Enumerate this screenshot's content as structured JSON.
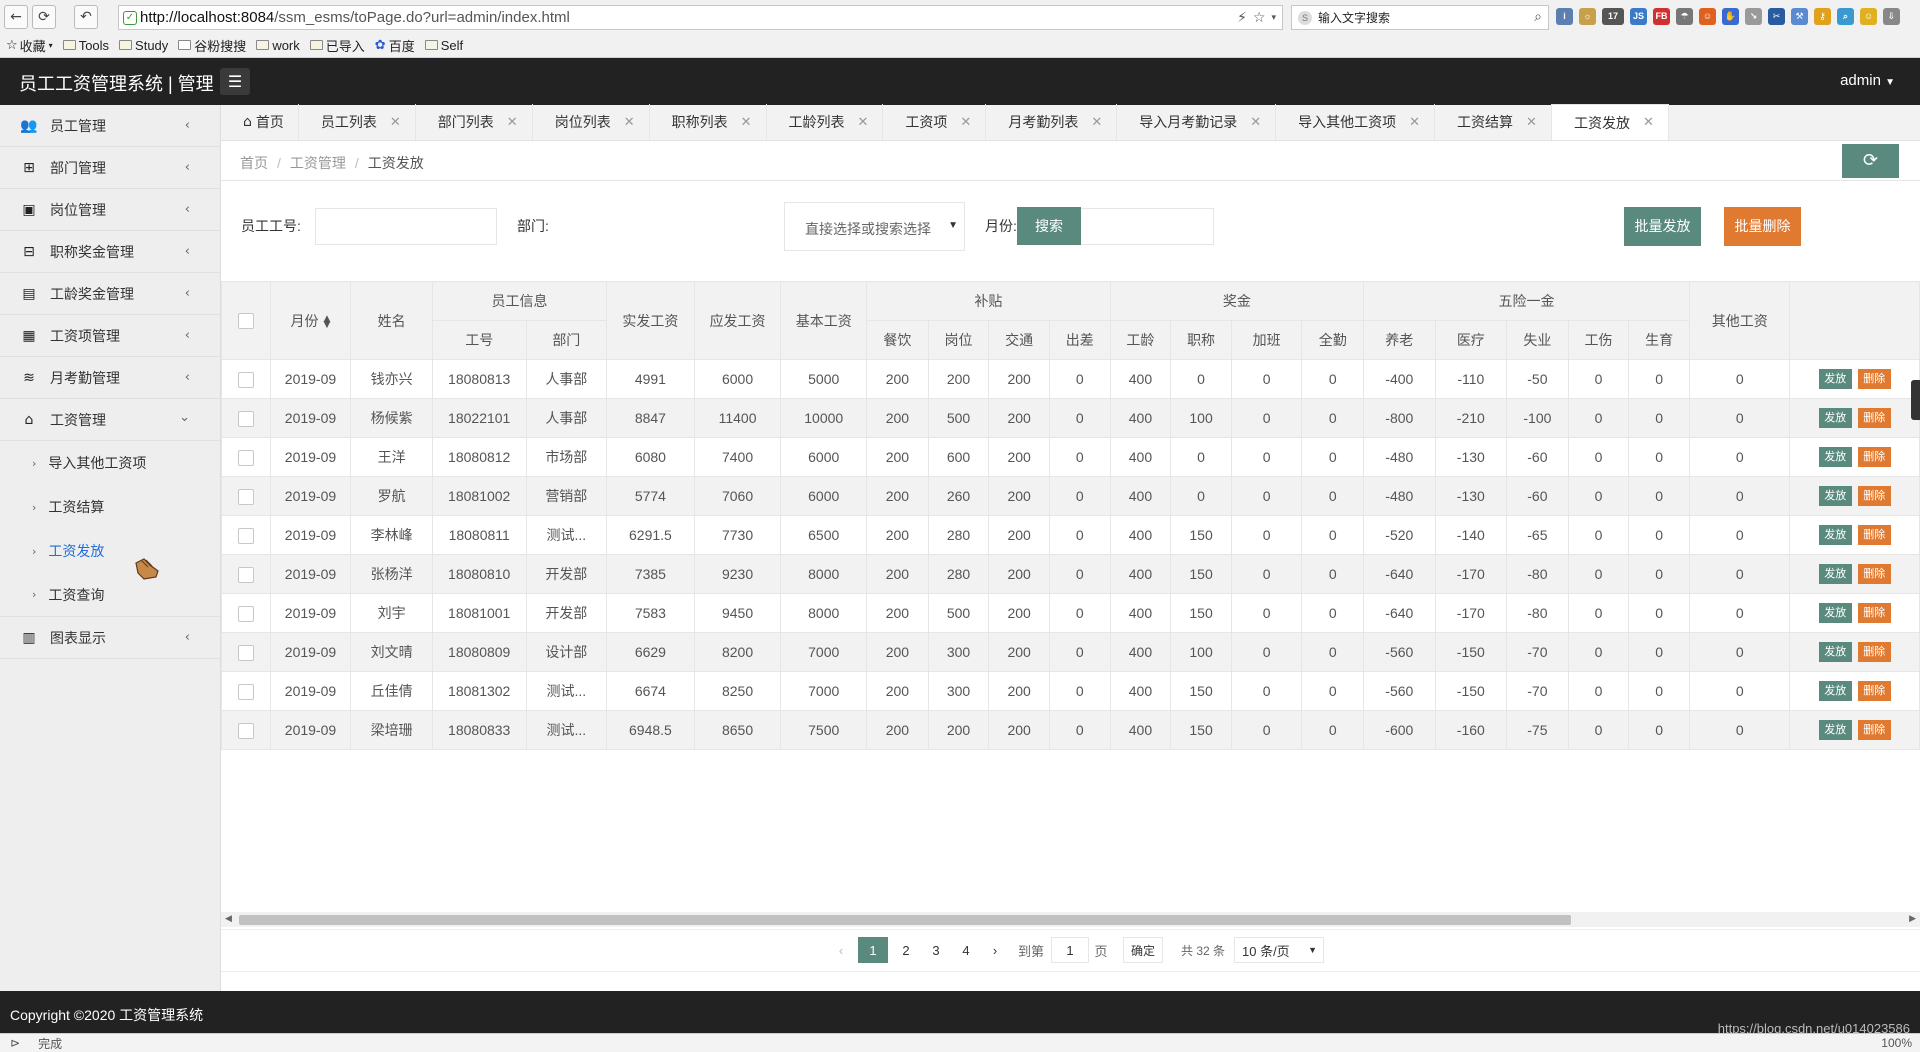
{
  "browser": {
    "url_host": "http://localhost:8084",
    "url_path": "/ssm_esms/toPage.do?url=admin/index.html",
    "search_placeholder": "输入文字搜索",
    "bookmarks": [
      "收藏",
      "Tools",
      "Study",
      "谷粉搜搜",
      "work",
      "已导入",
      "百度",
      "Self"
    ],
    "ext_badge": "17",
    "status_text": "完成",
    "zoom": "100%"
  },
  "app": {
    "title": "员工工资管理系统 | 管理",
    "user": "admin",
    "footer": "Copyright ©2020 工资管理系统",
    "watermark": "https://blog.csdn.net/u014023586"
  },
  "sidebar": {
    "items": [
      {
        "label": "员工管理"
      },
      {
        "label": "部门管理"
      },
      {
        "label": "岗位管理"
      },
      {
        "label": "职称奖金管理"
      },
      {
        "label": "工龄奖金管理"
      },
      {
        "label": "工资项管理"
      },
      {
        "label": "月考勤管理"
      },
      {
        "label": "工资管理"
      }
    ],
    "sub_items": [
      {
        "label": "导入其他工资项"
      },
      {
        "label": "工资结算"
      },
      {
        "label": "工资发放"
      },
      {
        "label": "工资查询"
      }
    ],
    "last_item": "图表显示"
  },
  "tabs": [
    "首页",
    "员工列表",
    "部门列表",
    "岗位列表",
    "职称列表",
    "工龄列表",
    "工资项",
    "月考勤列表",
    "导入月考勤记录",
    "导入其他工资项",
    "工资结算",
    "工资发放"
  ],
  "breadcrumb": [
    "首页",
    "工资管理",
    "工资发放"
  ],
  "search": {
    "emp_no_label": "员工工号:",
    "dept_label": "部门:",
    "dept_placeholder": "直接选择或搜索选择",
    "month_label": "月份:",
    "search_button": "搜索",
    "batch_issue": "批量发放",
    "batch_delete": "批量删除"
  },
  "table": {
    "group_headers": {
      "month": "月份",
      "name": "姓名",
      "emp_info": "员工信息",
      "actual": "实发工资",
      "payable": "应发工资",
      "base": "基本工资",
      "allowance": "补贴",
      "bonus": "奖金",
      "insurance": "五险一金",
      "other": "其他工资"
    },
    "sub_headers": {
      "emp_no": "工号",
      "dept": "部门",
      "meal": "餐饮",
      "post": "岗位",
      "traffic": "交通",
      "travel": "出差",
      "seniority": "工龄",
      "title": "职称",
      "overtime": "加班",
      "attendance": "全勤",
      "pension": "养老",
      "medical": "医疗",
      "unemployment": "失业",
      "injury": "工伤",
      "maternity": "生育"
    },
    "action_issue": "发放",
    "action_delete": "删除",
    "rows": [
      [
        "2019-09",
        "钱亦兴",
        "18080813",
        "人事部",
        "4991",
        "6000",
        "5000",
        "200",
        "200",
        "200",
        "0",
        "400",
        "0",
        "0",
        "0",
        "-400",
        "-110",
        "-50",
        "0",
        "0",
        "0"
      ],
      [
        "2019-09",
        "杨候紫",
        "18022101",
        "人事部",
        "8847",
        "11400",
        "10000",
        "200",
        "500",
        "200",
        "0",
        "400",
        "100",
        "0",
        "0",
        "-800",
        "-210",
        "-100",
        "0",
        "0",
        "0"
      ],
      [
        "2019-09",
        "王洋",
        "18080812",
        "市场部",
        "6080",
        "7400",
        "6000",
        "200",
        "600",
        "200",
        "0",
        "400",
        "0",
        "0",
        "0",
        "-480",
        "-130",
        "-60",
        "0",
        "0",
        "0"
      ],
      [
        "2019-09",
        "罗航",
        "18081002",
        "营销部",
        "5774",
        "7060",
        "6000",
        "200",
        "260",
        "200",
        "0",
        "400",
        "0",
        "0",
        "0",
        "-480",
        "-130",
        "-60",
        "0",
        "0",
        "0"
      ],
      [
        "2019-09",
        "李林峰",
        "18080811",
        "测试...",
        "6291.5",
        "7730",
        "6500",
        "200",
        "280",
        "200",
        "0",
        "400",
        "150",
        "0",
        "0",
        "-520",
        "-140",
        "-65",
        "0",
        "0",
        "0"
      ],
      [
        "2019-09",
        "张杨洋",
        "18080810",
        "开发部",
        "7385",
        "9230",
        "8000",
        "200",
        "280",
        "200",
        "0",
        "400",
        "150",
        "0",
        "0",
        "-640",
        "-170",
        "-80",
        "0",
        "0",
        "0"
      ],
      [
        "2019-09",
        "刘宇",
        "18081001",
        "开发部",
        "7583",
        "9450",
        "8000",
        "200",
        "500",
        "200",
        "0",
        "400",
        "150",
        "0",
        "0",
        "-640",
        "-170",
        "-80",
        "0",
        "0",
        "0"
      ],
      [
        "2019-09",
        "刘文晴",
        "18080809",
        "设计部",
        "6629",
        "8200",
        "7000",
        "200",
        "300",
        "200",
        "0",
        "400",
        "100",
        "0",
        "0",
        "-560",
        "-150",
        "-70",
        "0",
        "0",
        "0"
      ],
      [
        "2019-09",
        "丘佳倩",
        "18081302",
        "测试...",
        "6674",
        "8250",
        "7000",
        "200",
        "300",
        "200",
        "0",
        "400",
        "150",
        "0",
        "0",
        "-560",
        "-150",
        "-70",
        "0",
        "0",
        "0"
      ],
      [
        "2019-09",
        "梁培珊",
        "18080833",
        "测试...",
        "6948.5",
        "8650",
        "7500",
        "200",
        "200",
        "200",
        "0",
        "400",
        "150",
        "0",
        "0",
        "-600",
        "-160",
        "-75",
        "0",
        "0",
        "0"
      ]
    ]
  },
  "pager": {
    "pages": [
      "1",
      "2",
      "3",
      "4"
    ],
    "current": "1",
    "goto_label": "到第",
    "goto_value": "1",
    "page_unit": "页",
    "confirm": "确定",
    "total": "共 32 条",
    "page_size": "10 条/页"
  },
  "colors": {
    "primary": "#5a8a7e",
    "danger": "#e07a30",
    "header_bg": "#222222"
  }
}
